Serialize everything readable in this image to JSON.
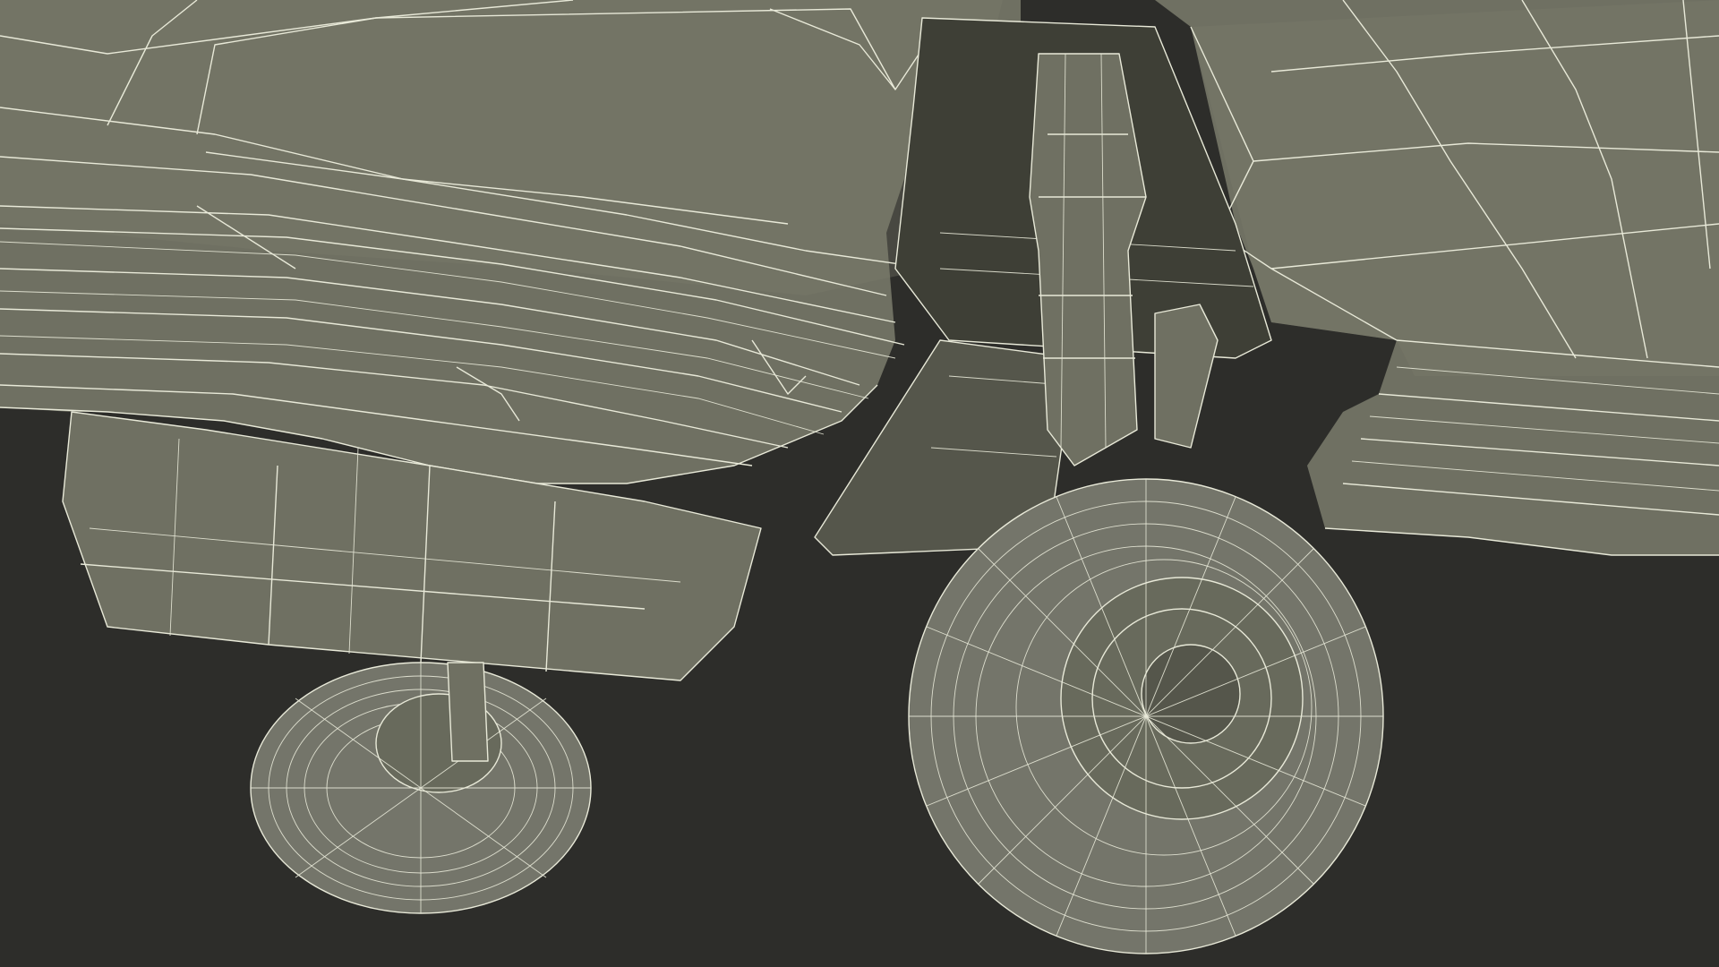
{
  "scene": {
    "colors": {
      "background": "#2d2d2a",
      "surface": "#6f7062",
      "wireframe": "#e8e9d8"
    }
  }
}
